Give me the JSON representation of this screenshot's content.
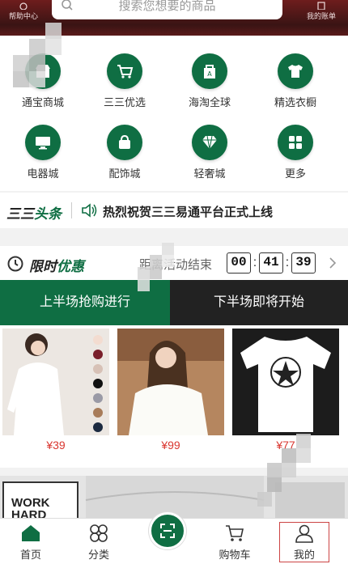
{
  "header": {
    "left_label": "帮助中心",
    "search_placeholder": "搜索您想要的商品",
    "right_label": "我的账单"
  },
  "categories": [
    {
      "label": "通宝商城",
      "icon": "shop-icon"
    },
    {
      "label": "三三优选",
      "icon": "cart-icon"
    },
    {
      "label": "海淘全球",
      "icon": "global-bag-icon"
    },
    {
      "label": "精选衣橱",
      "icon": "shirt-icon"
    },
    {
      "label": "电器城",
      "icon": "monitor-icon"
    },
    {
      "label": "配饰城",
      "icon": "bag-icon"
    },
    {
      "label": "轻奢城",
      "icon": "diamond-icon"
    },
    {
      "label": "更多",
      "icon": "grid-icon"
    }
  ],
  "news": {
    "brand_a": "三三",
    "brand_b": "头条",
    "text": "热烈祝贺三三易通平台正式上线"
  },
  "flash": {
    "title_a": "限时",
    "title_b": "优惠",
    "ends_label": "距离活动结束",
    "hours": "00",
    "minutes": "41",
    "seconds": "39"
  },
  "tabs": {
    "first_half": "上半场抢购进行",
    "second_half": "下半场即将开始"
  },
  "products": [
    {
      "price": "¥39"
    },
    {
      "price": "¥99"
    },
    {
      "price": "¥77"
    }
  ],
  "banner": {
    "text": "WORK HARD"
  },
  "nav": {
    "home": "首页",
    "category": "分类",
    "cart": "购物车",
    "me": "我的"
  },
  "colors": {
    "brand_green": "#0f6e43",
    "price_red": "#d9362f"
  }
}
